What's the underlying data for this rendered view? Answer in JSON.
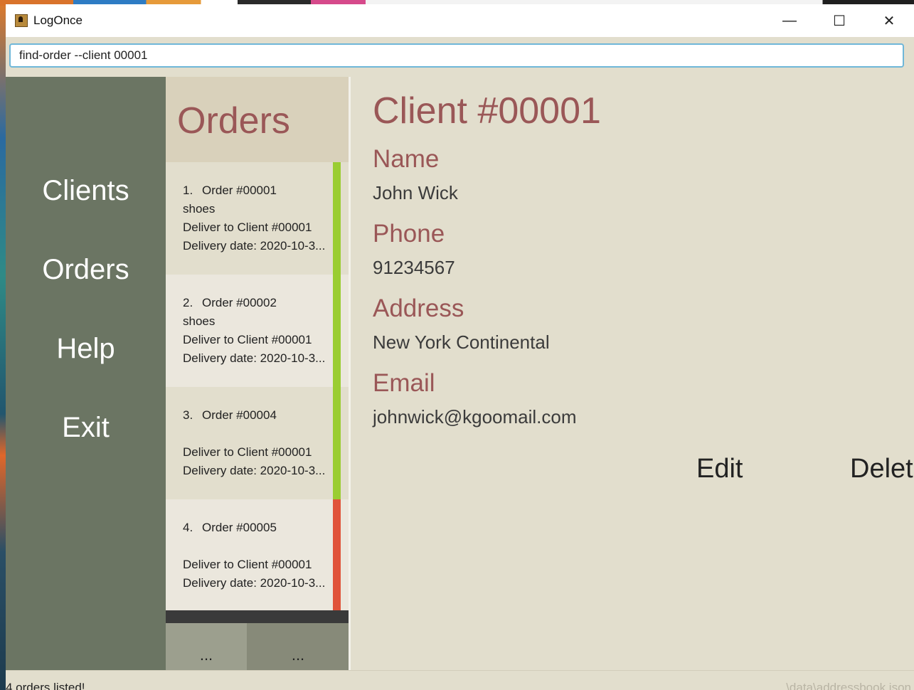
{
  "window": {
    "title": "LogOnce",
    "controls": {
      "minimize": "—",
      "maximize": "☐",
      "close": "✕"
    }
  },
  "command": {
    "value": "find-order --client 00001"
  },
  "nav": {
    "items": [
      "Clients",
      "Orders",
      "Help",
      "Exit"
    ]
  },
  "orders": {
    "title": "Orders",
    "items": [
      {
        "index": "1.",
        "title": "Order #00001",
        "description": "shoes",
        "deliver_to": "Deliver to Client #00001",
        "delivery": "Delivery date: 2020-10-3...",
        "status_color": "#9acd32"
      },
      {
        "index": "2.",
        "title": "Order #00002",
        "description": "shoes",
        "deliver_to": "Deliver to Client #00001",
        "delivery": "Delivery date: 2020-10-3...",
        "status_color": "#9acd32"
      },
      {
        "index": "3.",
        "title": "Order #00004",
        "description": "",
        "deliver_to": "Deliver to Client #00001",
        "delivery": "Delivery date: 2020-10-3...",
        "status_color": "#9acd32"
      },
      {
        "index": "4.",
        "title": "Order #00005",
        "description": "",
        "deliver_to": "Deliver to Client #00001",
        "delivery": "Delivery date: 2020-10-3...",
        "status_color": "#e0533a"
      }
    ],
    "more_buttons": [
      "...",
      "..."
    ]
  },
  "client": {
    "title": "Client #00001",
    "fields": [
      {
        "label": "Name",
        "value": "John Wick"
      },
      {
        "label": "Phone",
        "value": "91234567"
      },
      {
        "label": "Address",
        "value": "New York Continental"
      },
      {
        "label": "Email",
        "value": "johnwick@kgoomail.com"
      }
    ],
    "actions": {
      "edit": "Edit",
      "delete": "Delete"
    }
  },
  "status": {
    "message": "4 orders listed!",
    "file": "\\data\\addressbook.json"
  }
}
